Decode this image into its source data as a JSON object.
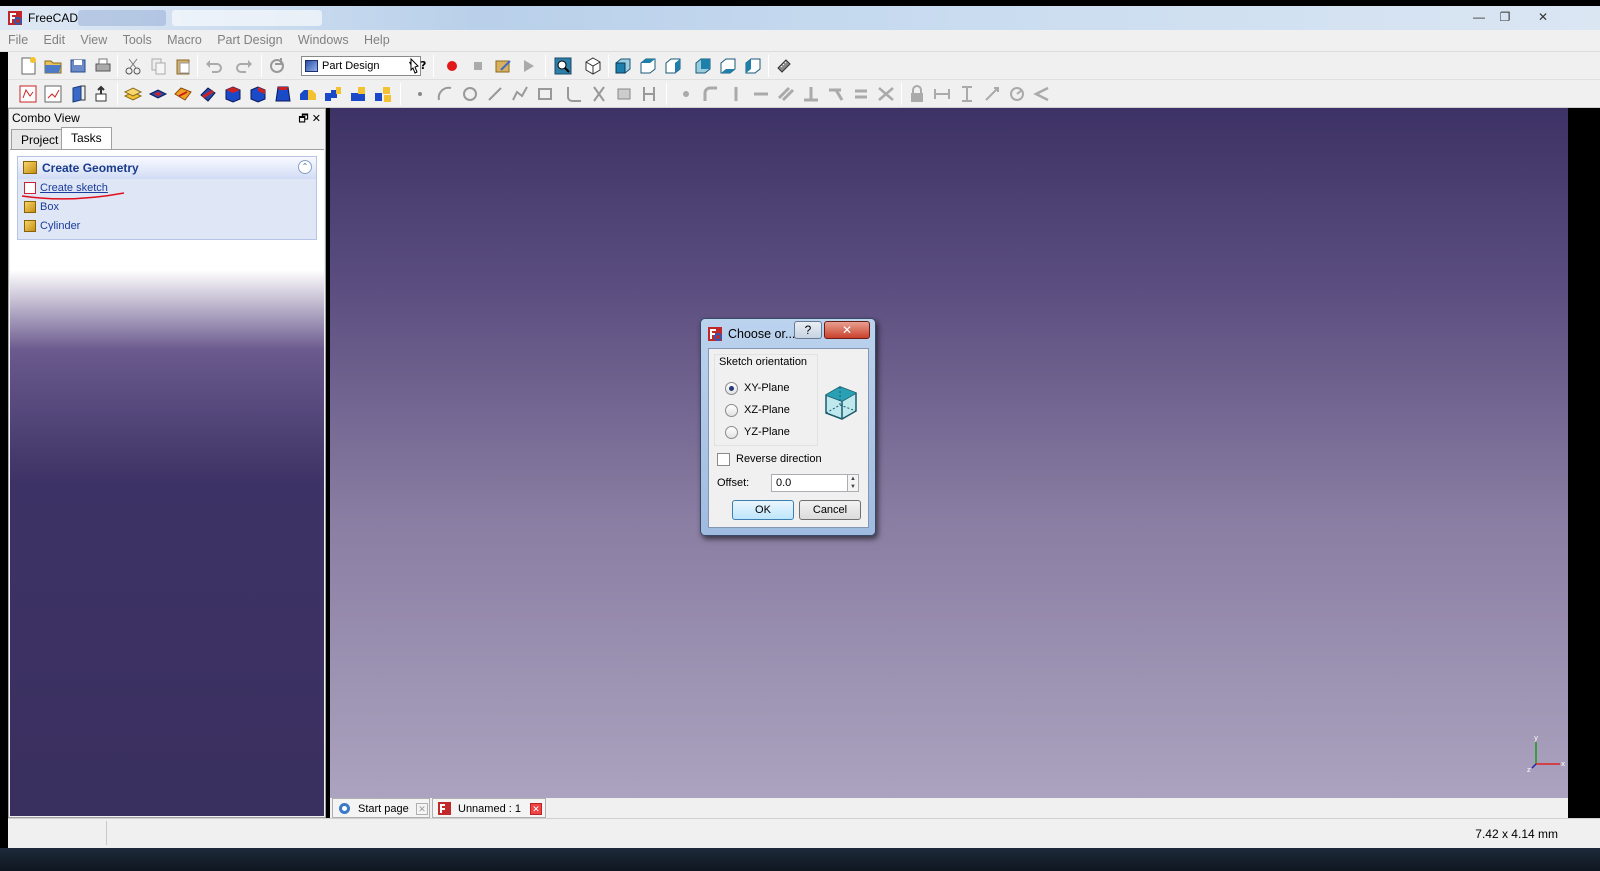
{
  "window": {
    "title": "FreeCAD"
  },
  "menubar": {
    "items": [
      "File",
      "Edit",
      "View",
      "Tools",
      "Macro",
      "Part Design",
      "Windows",
      "Help"
    ]
  },
  "toolbar": {
    "workbench": "Part Design"
  },
  "combo_view": {
    "title": "Combo View",
    "tabs": [
      "Project",
      "Tasks"
    ],
    "active_tab": "Tasks",
    "task_panel": {
      "title": "Create Geometry",
      "items": [
        {
          "label": "Create sketch",
          "icon": "sketch-icon"
        },
        {
          "label": "Box",
          "icon": "box-icon"
        },
        {
          "label": "Cylinder",
          "icon": "cylinder-icon"
        }
      ]
    }
  },
  "dialog": {
    "title": "Choose or...",
    "help_label": "?",
    "group_title": "Sketch orientation",
    "options": [
      "XY-Plane",
      "XZ-Plane",
      "YZ-Plane"
    ],
    "selected": "XY-Plane",
    "reverse_label": "Reverse direction",
    "reverse_checked": false,
    "offset_label": "Offset:",
    "offset_value": "0.0",
    "ok_label": "OK",
    "cancel_label": "Cancel"
  },
  "doc_tabs": [
    {
      "label": "Start page"
    },
    {
      "label": "Unnamed : 1"
    }
  ],
  "axis": {
    "x": "x",
    "y": "y",
    "z": "z"
  },
  "status": {
    "dimensions": "7.42 x 4.14 mm"
  },
  "colors": {
    "viewport_top": "#3d3265",
    "viewport_bottom": "#aba3bf",
    "task_link": "#1a3c9c",
    "annotation_red": "#e01020"
  }
}
